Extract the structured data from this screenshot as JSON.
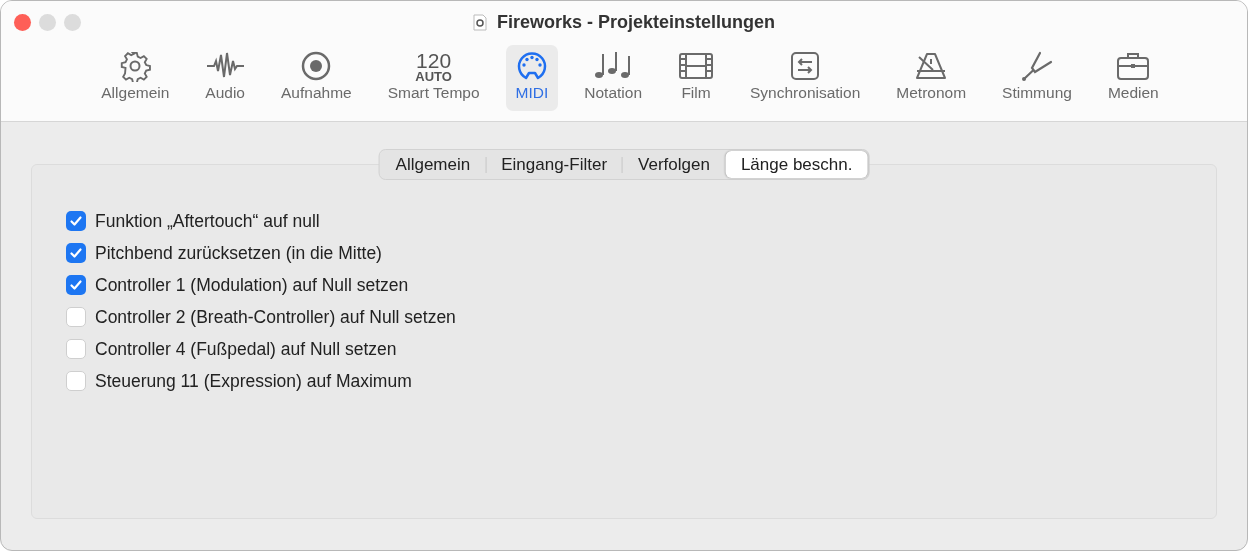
{
  "window": {
    "title": "Fireworks - Projekteinstellungen"
  },
  "toolbar": [
    {
      "kind": "icon",
      "label": "Allgemein",
      "selected": false
    },
    {
      "kind": "icon",
      "label": "Audio",
      "selected": false
    },
    {
      "kind": "icon",
      "label": "Aufnahme",
      "selected": false
    },
    {
      "kind": "tempo",
      "value": "120",
      "mode": "AUTO",
      "label": "Smart Tempo",
      "selected": false
    },
    {
      "kind": "icon",
      "label": "MIDI",
      "selected": true
    },
    {
      "kind": "icon",
      "label": "Notation",
      "selected": false
    },
    {
      "kind": "icon",
      "label": "Film",
      "selected": false
    },
    {
      "kind": "icon",
      "label": "Synchronisation",
      "selected": false
    },
    {
      "kind": "icon",
      "label": "Metronom",
      "selected": false
    },
    {
      "kind": "icon",
      "label": "Stimmung",
      "selected": false
    },
    {
      "kind": "icon",
      "label": "Medien",
      "selected": false
    }
  ],
  "tabs": [
    {
      "label": "Allgemein",
      "selected": false
    },
    {
      "label": "Eingang-Filter",
      "selected": false
    },
    {
      "label": "Verfolgen",
      "selected": false
    },
    {
      "label": "Länge beschn.",
      "selected": true
    }
  ],
  "options": [
    {
      "label": "Funktion „Aftertouch“ auf null",
      "checked": true
    },
    {
      "label": "Pitchbend zurücksetzen (in die Mitte)",
      "checked": true
    },
    {
      "label": "Controller 1 (Modulation) auf Null setzen",
      "checked": true
    },
    {
      "label": "Controller 2 (Breath-Controller) auf Null setzen",
      "checked": false
    },
    {
      "label": "Controller 4 (Fußpedal) auf Null setzen",
      "checked": false
    },
    {
      "label": "Steuerung 11 (Expression) auf Maximum",
      "checked": false
    }
  ]
}
